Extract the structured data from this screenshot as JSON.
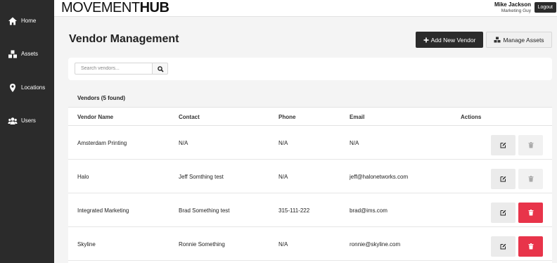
{
  "sidebar": {
    "items": [
      {
        "label": "Home",
        "icon": "home-icon"
      },
      {
        "label": "Assets",
        "icon": "boxes-icon"
      },
      {
        "label": "Locations",
        "icon": "map-pin-icon"
      },
      {
        "label": "Users",
        "icon": "users-icon"
      }
    ]
  },
  "header": {
    "logo_thin": "MOVEMENT",
    "logo_bold": "HUB",
    "user_name": "Mike Jackson",
    "user_role": "Marketing Guy",
    "logout_label": "Logout"
  },
  "main": {
    "title": "Vendor Management",
    "add_button_label": "Add New Vendor",
    "manage_button_label": "Manage Assets",
    "search": {
      "placeholder": "Search vendors...",
      "value": ""
    },
    "table": {
      "title": "Vendors (5 found)",
      "columns": [
        "Vendor Name",
        "Contact",
        "Phone",
        "Email",
        "Actions"
      ],
      "rows": [
        {
          "name": "Amsterdam Printing",
          "contact": "N/A",
          "phone": "N/A",
          "email": "N/A",
          "delete_enabled": false
        },
        {
          "name": "Halo",
          "contact": "Jeff Somthing test",
          "phone": "N/A",
          "email": "jeff@halonetworks.com",
          "delete_enabled": false
        },
        {
          "name": "Integrated Marketing",
          "contact": "Brad Something test",
          "phone": "315-111-222",
          "email": "brad@ims.com",
          "delete_enabled": true
        },
        {
          "name": "Skyline",
          "contact": "Ronnie Something",
          "phone": "N/A",
          "email": "ronnie@skyline.com",
          "delete_enabled": true
        }
      ]
    }
  },
  "colors": {
    "sidebar_bg": "#2b2b2b",
    "danger": "#e8344a",
    "primary_dark": "#2b2b2b"
  }
}
